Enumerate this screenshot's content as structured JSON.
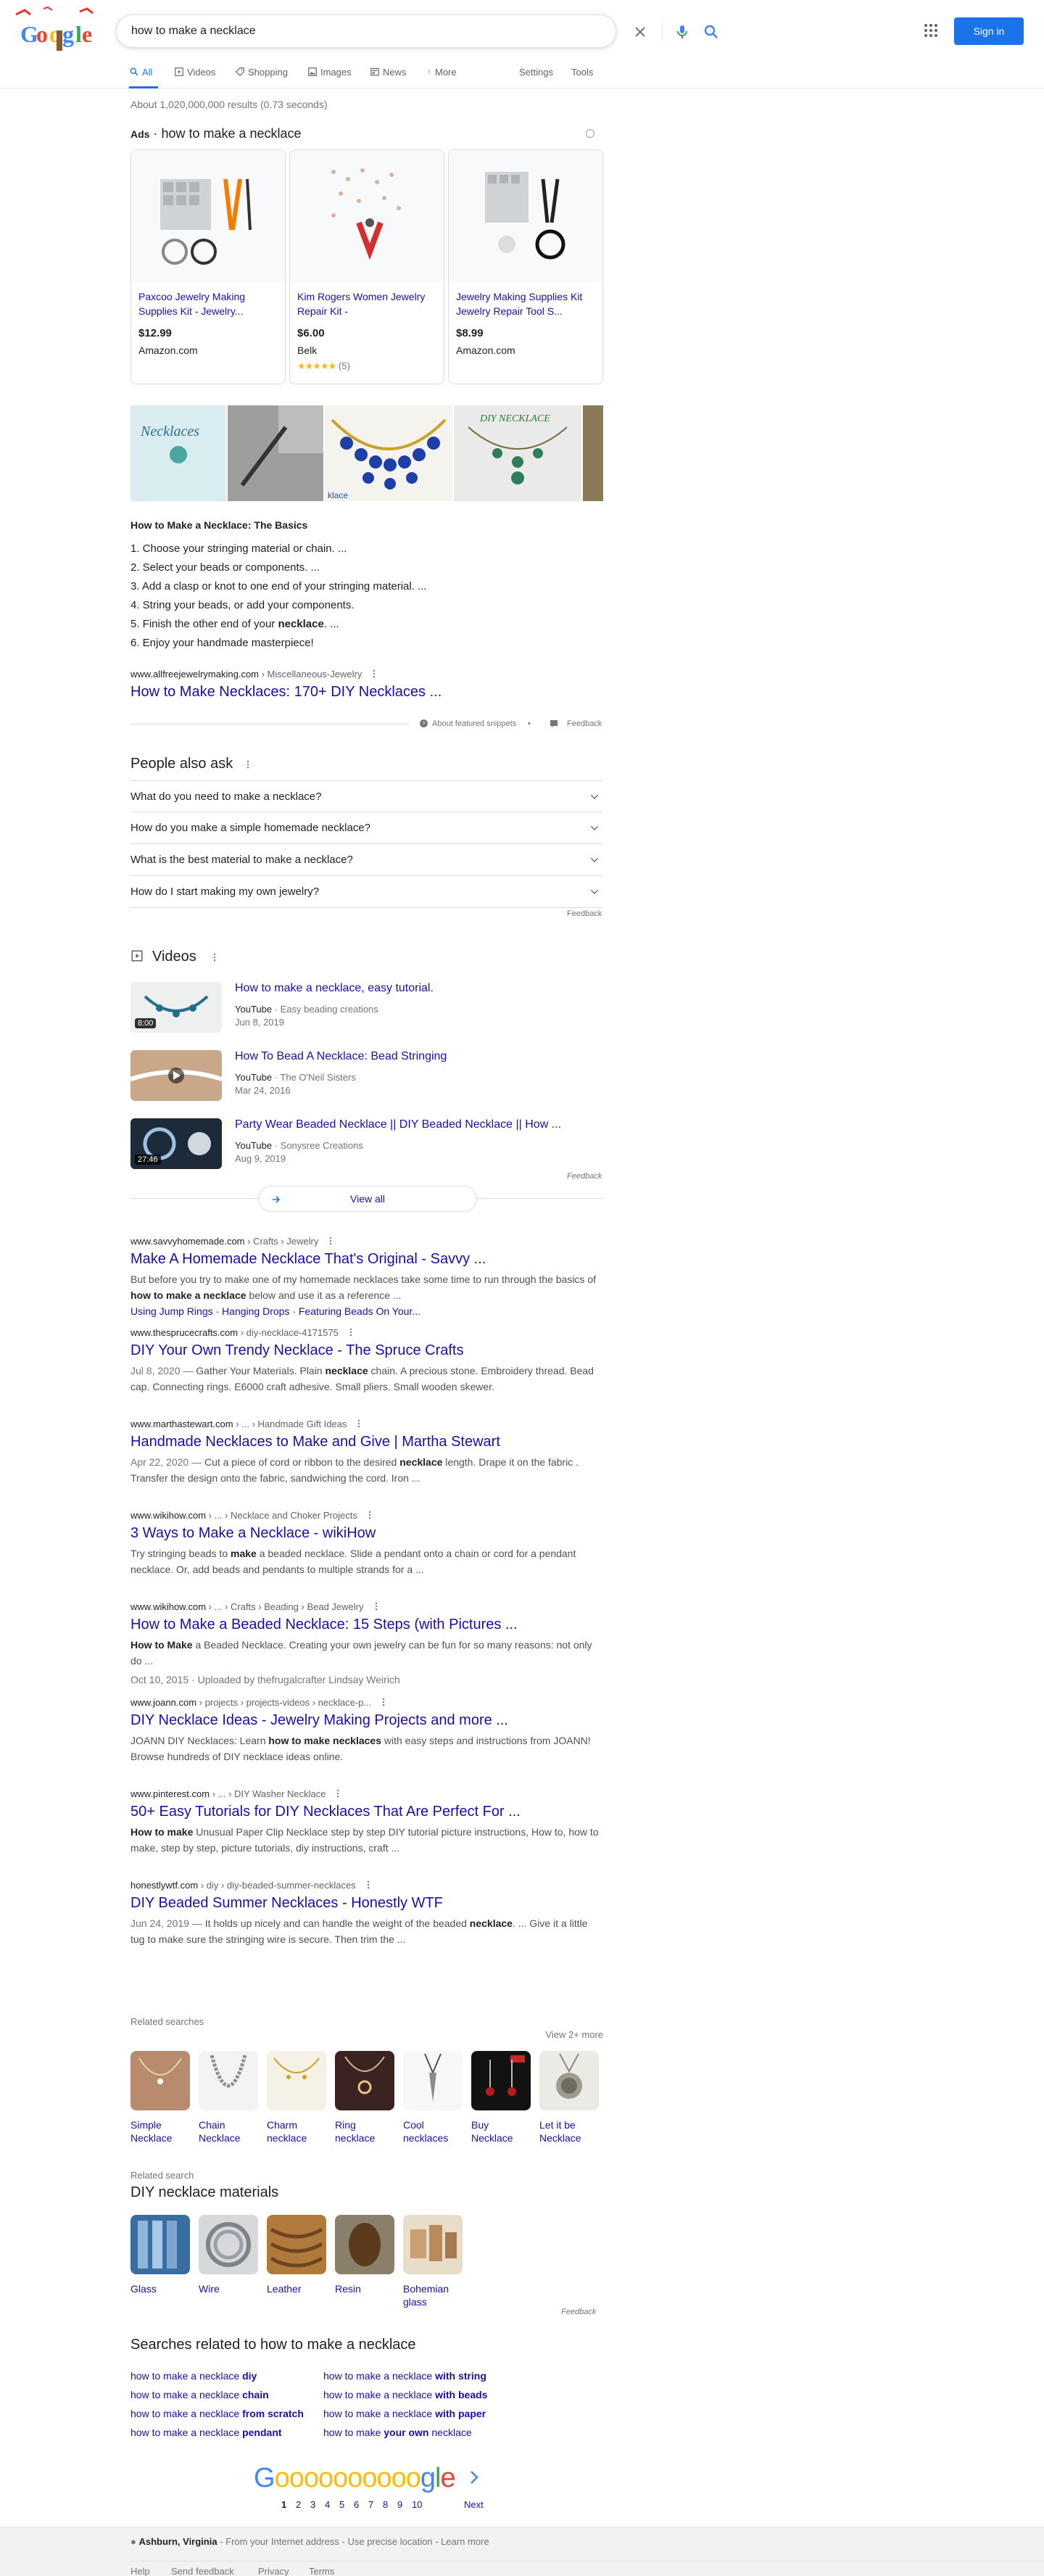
{
  "search": {
    "query": "how to make a necklace",
    "signin": "Sign in"
  },
  "tabs": [
    {
      "label": "All"
    },
    {
      "label": "Videos"
    },
    {
      "label": "Shopping"
    },
    {
      "label": "Images"
    },
    {
      "label": "News"
    },
    {
      "label": "More"
    },
    {
      "label": "Settings"
    },
    {
      "label": "Tools"
    }
  ],
  "stats": "About 1,020,000,000 results (0.73 seconds)",
  "ads": {
    "label": "Ads",
    "title": "how to make a necklace",
    "items": [
      {
        "name": "Paxcoo Jewelry Making Supplies Kit - Jewelry...",
        "price": "$12.99",
        "store": "Amazon.com",
        "rating": ""
      },
      {
        "name": "Kim Rogers Women Jewelry Repair Kit -",
        "price": "$6.00",
        "store": "Belk",
        "rating": "(5)"
      },
      {
        "name": "Jewelry Making Supplies Kit Jewelry Repair Tool S...",
        "price": "$8.99",
        "store": "Amazon.com",
        "rating": ""
      }
    ]
  },
  "strip": {
    "t1": "Necklaces",
    "t2": "DIY NECKLACE",
    "t3": "klace"
  },
  "featured": {
    "title": "How to Make a Necklace: The Basics",
    "steps": [
      "1. Choose your stringing material or chain. ...",
      "2. Select your beads or components. ...",
      "3. Add a clasp or knot to one end of your stringing material. ...",
      "4. String your beads, or add your components.",
      "5. Finish the other end of your ",
      "6. Enjoy your handmade masterpiece!"
    ],
    "step5_bold": "necklace",
    "step5_end": ". ...",
    "cite_domain": "www.allfreejewelrymaking.com",
    "cite_crumb": " › Miscellaneous-Jewelry",
    "link": "How to Make Necklaces: 170+ DIY Necklaces ...",
    "about": "About featured snippets",
    "feedback": "Feedback"
  },
  "paa": {
    "title": "People also ask",
    "questions": [
      "What do you need to make a necklace?",
      "How do you make a simple homemade necklace?",
      "What is the best material to make a necklace?",
      "How do I start making my own jewelry?"
    ],
    "feedback": "Feedback"
  },
  "videos": {
    "title": "Videos",
    "items": [
      {
        "title": "How to make a necklace, easy tutorial.",
        "source": "YouTube",
        "channel": " · Easy beading creations",
        "date": "Jun 8, 2019",
        "duration": "8:00"
      },
      {
        "title": "How To Bead A Necklace: Bead Stringing",
        "source": "YouTube",
        "channel": " · The O'Neil Sisters",
        "date": "Mar 24, 2016",
        "duration": ""
      },
      {
        "title": "Party Wear Beaded Necklace || DIY Beaded Necklace || How ...",
        "source": "YouTube",
        "channel": " · Sonysree Creations",
        "date": "Aug 9, 2019",
        "duration": "27:46"
      }
    ],
    "feedback": "Feedback",
    "view_all": "View all"
  },
  "results": [
    {
      "domain": "www.savvyhomemade.com",
      "crumb": " › Crafts › Jewelry",
      "title": "Make A Homemade Necklace That's Original - Savvy ...",
      "date": "",
      "s1": "But before you try to make one of my homemade necklaces take some time to run through the basics of ",
      "b1": "how to make a necklace",
      "s2": " below and use it as a reference ...",
      "sub": "Using Jump Rings · Hanging Drops · Featuring Beads On Your..."
    },
    {
      "domain": "www.thesprucecrafts.com",
      "crumb": " › diy-necklace-4171575",
      "title": "DIY Your Own Trendy Necklace - The Spruce Crafts",
      "date": "Jul 8, 2020 — ",
      "s1": "Gather Your Materials. Plain ",
      "b1": "necklace",
      "s2": " chain. A precious stone. Embroidery thread. Bead cap. Connecting rings. E6000 craft adhesive. Small pliers. Small wooden skewer.",
      "sub": ""
    },
    {
      "domain": "www.marthastewart.com",
      "crumb": " › ... › Handmade Gift Ideas",
      "title": "Handmade Necklaces to Make and Give | Martha Stewart",
      "date": "Apr 22, 2020 — ",
      "s1": "Cut a piece of cord or ribbon to the desired ",
      "b1": "necklace",
      "s2": " length. Drape it on the fabric . Transfer the design onto the fabric, sandwiching the cord. Iron ...",
      "sub": ""
    },
    {
      "domain": "www.wikihow.com",
      "crumb": " › ... › Necklace and Choker Projects",
      "title": "3 Ways to Make a Necklace - wikiHow",
      "date": "",
      "s1": "Try stringing beads to ",
      "b1": "make",
      "s2": " a beaded necklace. Slide a pendant onto a chain or cord for a pendant necklace. Or, add beads and pendants to multiple strands for a ...",
      "sub": ""
    },
    {
      "domain": "www.wikihow.com",
      "crumb": " › ... › Crafts › Beading › Bead Jewelry",
      "title": "How to Make a Beaded Necklace: 15 Steps (with Pictures ...",
      "date": "",
      "s1": "",
      "b1": "How to Make",
      "s2": " a Beaded Necklace. Creating your own jewelry can be fun for so many reasons: not only do ...",
      "sub": "",
      "extra": "Oct 10, 2015 · Uploaded by thefrugalcrafter Lindsay Weirich"
    },
    {
      "domain": "www.joann.com",
      "crumb": " › projects › projects-videos › necklace-p...",
      "title": "DIY Necklace Ideas - Jewelry Making Projects and more ...",
      "date": "",
      "s1": "JOANN DIY Necklaces: Learn ",
      "b1": "how to make necklaces",
      "s2": " with easy steps and instructions from JOANN! Browse hundreds of DIY necklace ideas online.",
      "sub": ""
    },
    {
      "domain": "www.pinterest.com",
      "crumb": " › ... › DIY Washer Necklace",
      "title": "50+ Easy Tutorials for DIY Necklaces That Are Perfect For ...",
      "date": "",
      "s1": "",
      "b1": "How to make",
      "s2": " Unusual Paper Clip Necklace step by step DIY tutorial picture instructions, How to, how to make, step by step, picture tutorials, diy instructions, craft ...",
      "sub": ""
    },
    {
      "domain": "honestlywtf.com",
      "crumb": " › diy › diy-beaded-summer-necklaces",
      "title": "DIY Beaded Summer Necklaces - Honestly WTF",
      "date": "Jun 24, 2019 — ",
      "s1": "It holds up nicely and can handle the weight of the beaded ",
      "b1": "necklace",
      "s2": ". ... Give it a little tug to make sure the stringing wire is secure. Then trim the ...",
      "sub": ""
    }
  ],
  "related": {
    "title": "Related searches",
    "more": "View 2+ more",
    "items": [
      "Simple Necklace",
      "Chain Necklace",
      "Charm necklace",
      "Ring necklace",
      "Cool necklaces",
      "Buy Necklace",
      "Let it be Necklace"
    ]
  },
  "materials": {
    "sub": "Related search",
    "title": "DIY necklace materials",
    "items": [
      "Glass",
      "Wire",
      "Leather",
      "Resin",
      "Bohemian glass"
    ],
    "feedback": "Feedback"
  },
  "searches_related": {
    "title": "Searches related to how to make a necklace",
    "prefix": "how to make a necklace",
    "left": [
      " diy",
      " chain",
      " from scratch",
      " pendant"
    ],
    "right": [
      " with string",
      " with beads",
      " with paper",
      ""
    ]
  },
  "pager": {
    "pages": [
      "1",
      "2",
      "3",
      "4",
      "5",
      "6",
      "7",
      "8",
      "9",
      "10"
    ],
    "next": "Next"
  },
  "footer": {
    "location": "Ashburn, Virginia",
    "loc_rest": " - From your Internet address - Use precise location - Learn more",
    "links": [
      "Help",
      "Send feedback",
      "Privacy",
      "Terms"
    ]
  },
  "colors": {
    "link": "#1a0dab",
    "accent": "#1a73e8",
    "text": "#202124",
    "muted": "#70757a"
  }
}
